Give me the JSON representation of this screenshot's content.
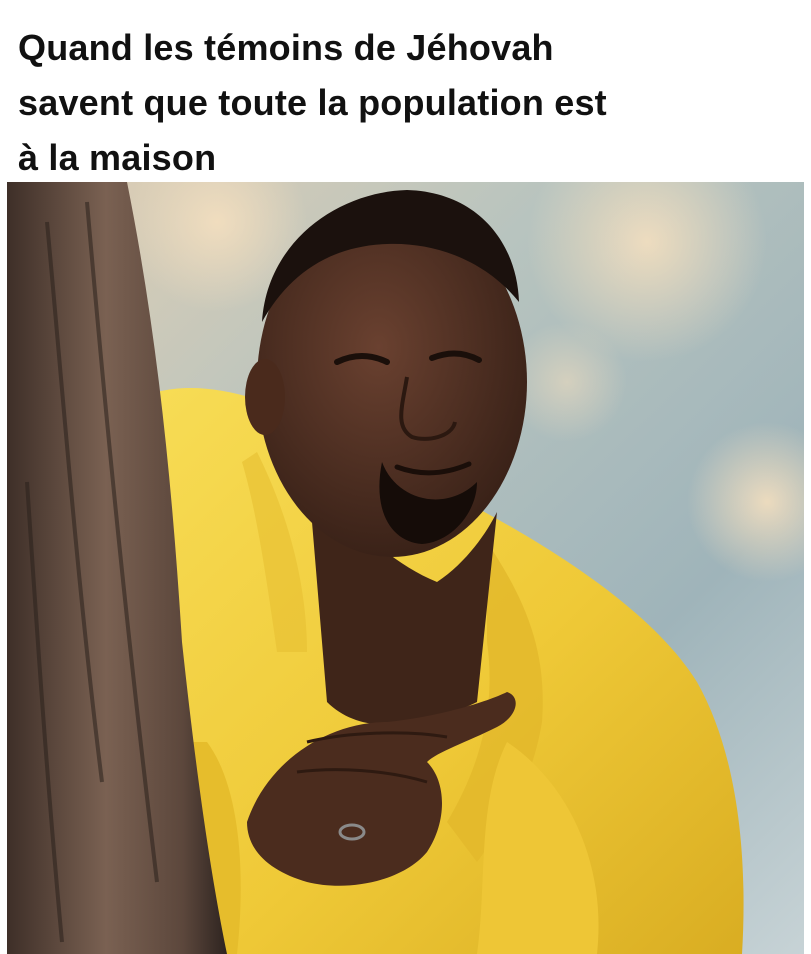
{
  "caption": {
    "lines": [
      "Quand les témoins de Jéhovah",
      "savent que toute la population est",
      "à la maison"
    ]
  },
  "photo": {
    "subject": "man in yellow suit peeking from behind tree, rubbing hands",
    "colors": {
      "suit": "#f2cf3e",
      "skin": "#4a2b1f",
      "tree": "#6b5347",
      "background": "#b9c7c9"
    }
  }
}
